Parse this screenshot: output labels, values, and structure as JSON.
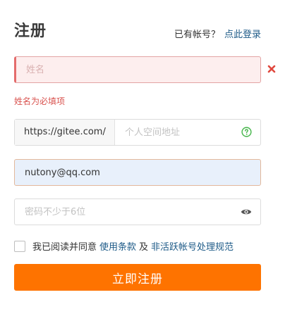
{
  "header": {
    "title": "注册",
    "have_account_text": "已有帐号？",
    "login_link": "点此登录"
  },
  "form": {
    "name": {
      "placeholder": "姓名",
      "value": "",
      "error": "姓名为必填项",
      "state": "error"
    },
    "personal_space": {
      "prefix": "https://gitee.com/",
      "placeholder": "个人空间地址",
      "value": ""
    },
    "email": {
      "placeholder": "",
      "value": "nutony@qq.com"
    },
    "password": {
      "placeholder": "密码不少于6位",
      "value": ""
    },
    "agreement": {
      "checked": false,
      "text_before": "我已阅读并同意",
      "terms_link": "使用条款",
      "and": "及",
      "policy_link": "非活跃帐号处理规范"
    },
    "submit_label": "立即注册"
  },
  "colors": {
    "primary": "#fe7300",
    "link": "#1d5a87",
    "error": "#d9534f",
    "help_icon": "#44b549"
  },
  "icons": {
    "name_error": "close-icon",
    "space_help": "question-circle-icon",
    "password_toggle": "eye-icon"
  }
}
